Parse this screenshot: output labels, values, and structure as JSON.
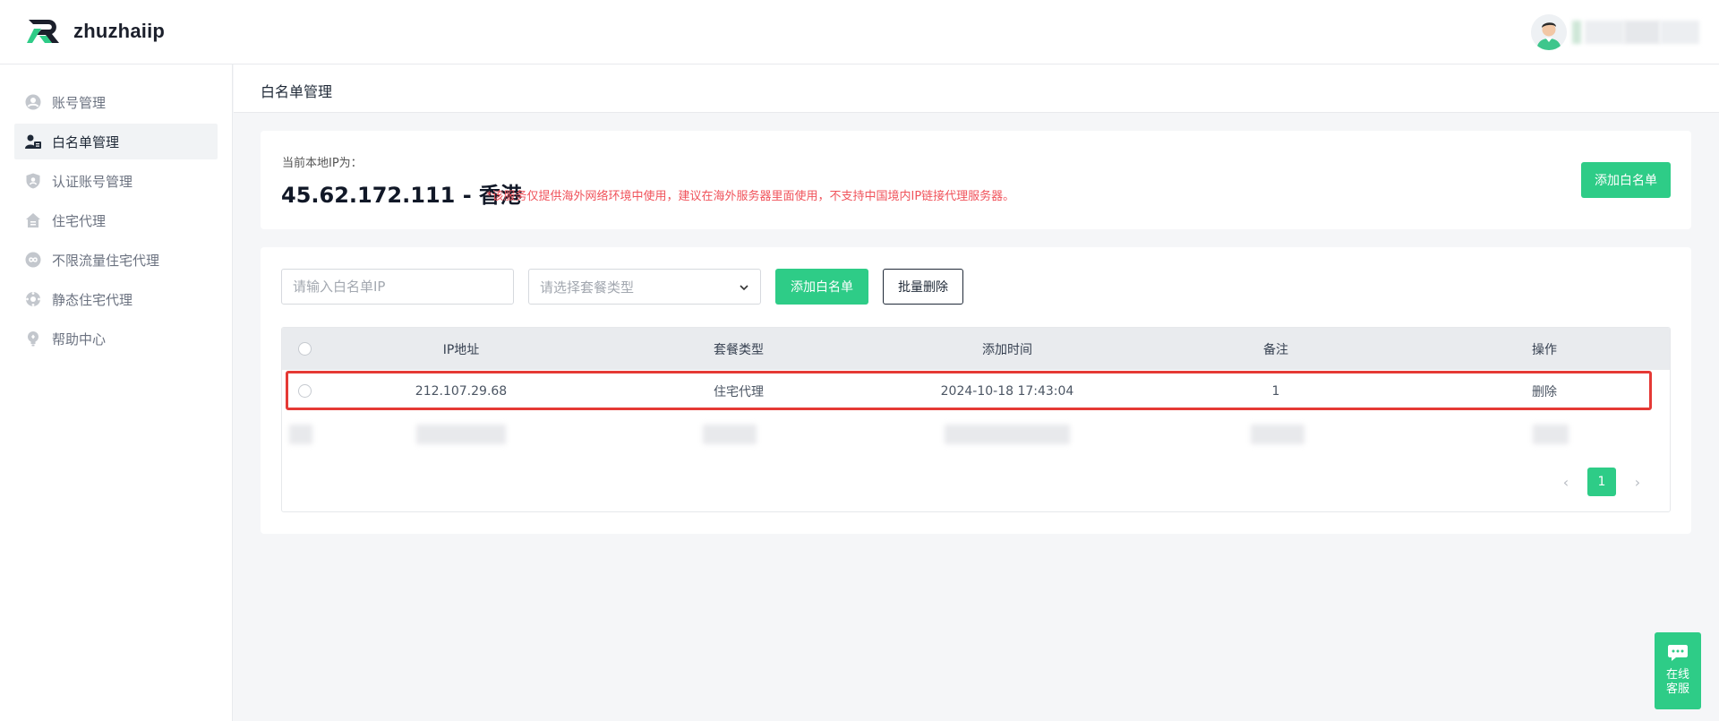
{
  "header": {
    "app_name": "zhuzhaiip",
    "brand_colors": {
      "green": "#2ecc87",
      "dark": "#1b1f2b"
    }
  },
  "sidebar": {
    "items": [
      {
        "label": "账号管理",
        "icon": "user-circle-icon",
        "active": false
      },
      {
        "label": "白名单管理",
        "icon": "user-list-icon",
        "active": true
      },
      {
        "label": "认证账号管理",
        "icon": "shield-user-icon",
        "active": false
      },
      {
        "label": "住宅代理",
        "icon": "home-icon",
        "active": false
      },
      {
        "label": "不限流量住宅代理",
        "icon": "infinity-icon",
        "active": false
      },
      {
        "label": "静态住宅代理",
        "icon": "globe-icon",
        "active": false
      },
      {
        "label": "帮助中心",
        "icon": "bulb-icon",
        "active": false
      }
    ]
  },
  "page": {
    "title": "白名单管理"
  },
  "ip_card": {
    "label": "当前本地IP为：",
    "value": "45.62.172.111 - 香港",
    "note": "*该服务仅提供海外网络环境中使用，建议在海外服务器里面使用，不支持中国境内IP链接代理服务器。",
    "add_button": "添加白名单"
  },
  "filters": {
    "ip_placeholder": "请输入白名单IP",
    "plan_placeholder": "请选择套餐类型",
    "add_button": "添加白名单",
    "batch_delete_button": "批量删除"
  },
  "table": {
    "headers": {
      "ip": "IP地址",
      "plan": "套餐类型",
      "time": "添加时间",
      "note": "备注",
      "op": "操作"
    },
    "rows": [
      {
        "ip": "212.107.29.68",
        "plan": "住宅代理",
        "time": "2024-10-18 17:43:04",
        "note": "1",
        "op": "删除"
      }
    ]
  },
  "pagination": {
    "prev": "‹",
    "current": "1",
    "next": "›"
  },
  "support": {
    "label_line1": "在线",
    "label_line2": "客服"
  },
  "colors": {
    "accent": "#2ecc87",
    "warning_text": "#f0525a",
    "highlight_border": "#e53935"
  }
}
